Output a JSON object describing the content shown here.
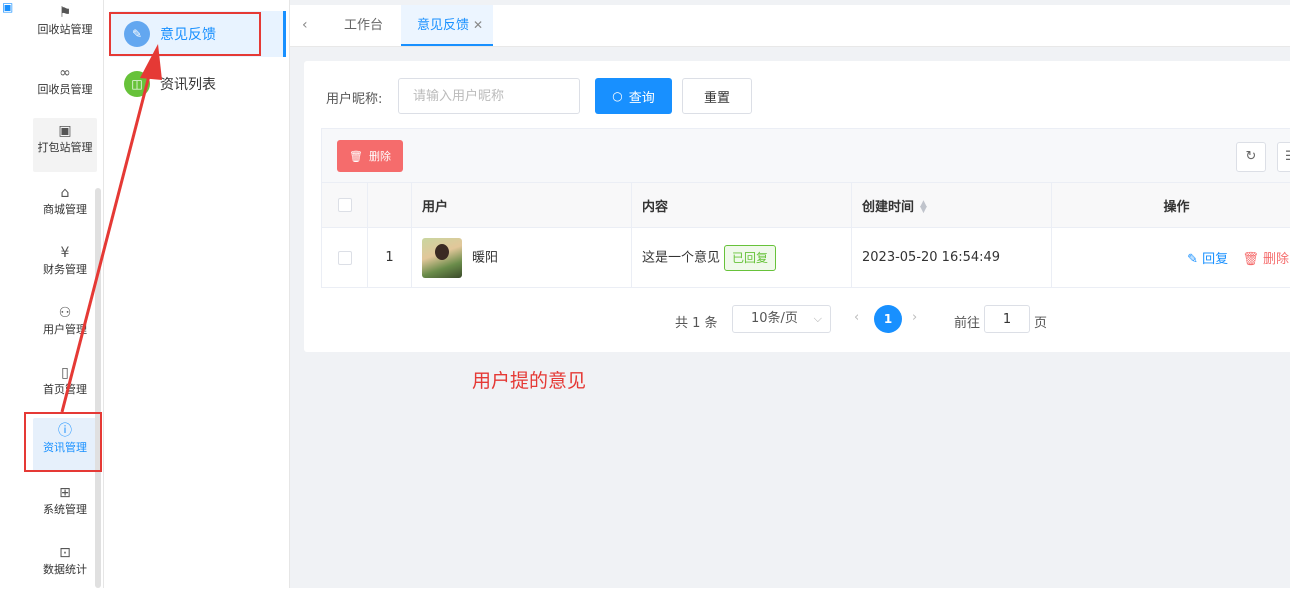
{
  "rail": {
    "items": [
      {
        "icon": "flag-icon",
        "label": "回收站管理"
      },
      {
        "icon": "infinity-icon",
        "label": "回收员管理"
      },
      {
        "icon": "package-icon",
        "label": "打包站管理"
      },
      {
        "icon": "shopping-bag-icon",
        "label": "商城管理"
      },
      {
        "icon": "yen-icon",
        "label": "财务管理"
      },
      {
        "icon": "users-icon",
        "label": "用户管理"
      },
      {
        "icon": "tablet-icon",
        "label": "首页管理"
      },
      {
        "icon": "info-icon",
        "label": "资讯管理"
      },
      {
        "icon": "grid-icon",
        "label": "系统管理"
      },
      {
        "icon": "chart-icon",
        "label": "数据统计"
      }
    ]
  },
  "submenu": {
    "items": [
      {
        "icon": "edit-icon",
        "label": "意见反馈"
      },
      {
        "icon": "book-icon",
        "label": "资讯列表"
      }
    ]
  },
  "tabs": {
    "items": [
      {
        "label": "工作台"
      },
      {
        "label": "意见反馈"
      }
    ]
  },
  "search": {
    "label": "用户昵称:",
    "placeholder": "请输入用户昵称",
    "query_label": "查询",
    "reset_label": "重置"
  },
  "toolbar": {
    "delete_label": "删除"
  },
  "table": {
    "headers": [
      "用户",
      "内容",
      "创建时间",
      "操作"
    ],
    "rows": [
      {
        "index": "1",
        "user": "暖阳",
        "content": "这是一个意见",
        "status": "已回复",
        "created": "2023-05-20 16:54:49",
        "reply": "回复",
        "delete": "删除"
      }
    ]
  },
  "pager": {
    "total": "共 1 条",
    "page_size": "10条/页",
    "current": "1",
    "goto_prefix": "前往",
    "goto_value": "1",
    "goto_suffix": "页"
  },
  "annotation": {
    "text": "用户提的意见",
    "color": "#e53935"
  },
  "colors": {
    "primary": "#1890ff",
    "danger": "#f56c6c",
    "success": "#67c23a"
  }
}
